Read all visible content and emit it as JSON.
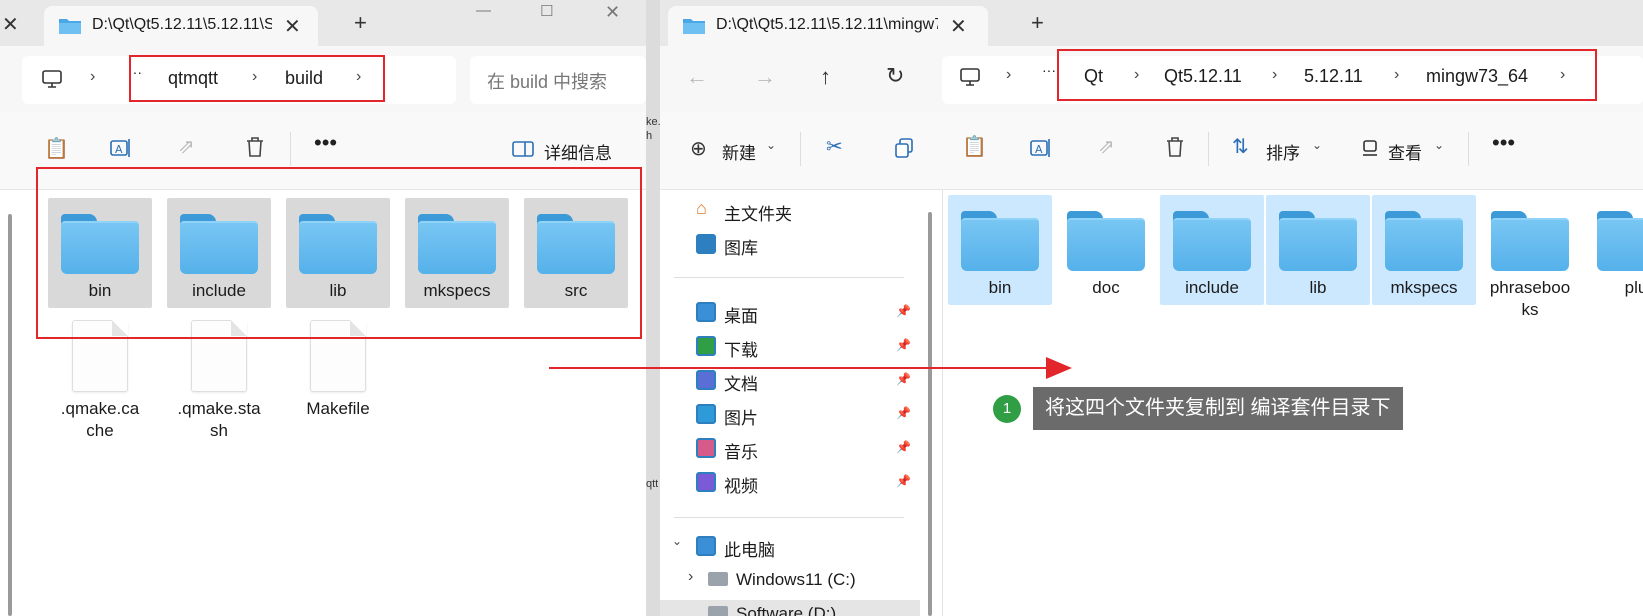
{
  "left_window": {
    "tab_title": "D:\\Qt\\Qt5.12.11\\5.12.11\\S",
    "tab_close": "✕",
    "new_tab": "+",
    "breadcrumbs": [
      "qtmqtt",
      "build"
    ],
    "more": "···",
    "search_placeholder": "在 build 中搜索",
    "details_label": "详细信息",
    "folders": [
      "bin",
      "include",
      "lib",
      "mkspecs",
      "src"
    ],
    "files": [
      ".qmake.ca\nche",
      ".qmake.sta\nsh",
      "Makefile"
    ]
  },
  "gap_text": [
    "ke.",
    "h",
    "qtt"
  ],
  "right_window": {
    "tab_title": "D:\\Qt\\Qt5.12.11\\5.12.11\\mingw7",
    "tab_close": "✕",
    "new_tab": "+",
    "more": "···",
    "breadcrumbs": [
      "Qt",
      "Qt5.12.11",
      "5.12.11",
      "mingw73_64"
    ],
    "toolbar": {
      "new_label": "新建",
      "sort_label": "排序",
      "view_label": "查看"
    },
    "nav": {
      "top": [
        "主文件夹",
        "图库"
      ],
      "quick_access": [
        "桌面",
        "下载",
        "文档",
        "图片",
        "音乐",
        "视频"
      ],
      "this_pc": "此电脑",
      "drives": [
        "Windows11 (C:)",
        "Software (D:)"
      ]
    },
    "folders": [
      {
        "name": "bin",
        "selected": true
      },
      {
        "name": "doc",
        "selected": false
      },
      {
        "name": "include",
        "selected": true
      },
      {
        "name": "lib",
        "selected": true
      },
      {
        "name": "mkspecs",
        "selected": true
      },
      {
        "name": "phraseboo\nks",
        "selected": false
      },
      {
        "name": "plu",
        "selected": false
      }
    ]
  },
  "annotation": {
    "step": "1",
    "text": "将这四个文件夹复制到 编译套件目录下"
  },
  "colors": {
    "highlight_red": "#e3262b",
    "badge_green": "#2f9e44",
    "selection_blue": "#cce8ff",
    "folder_blue": "#55b1ea"
  }
}
